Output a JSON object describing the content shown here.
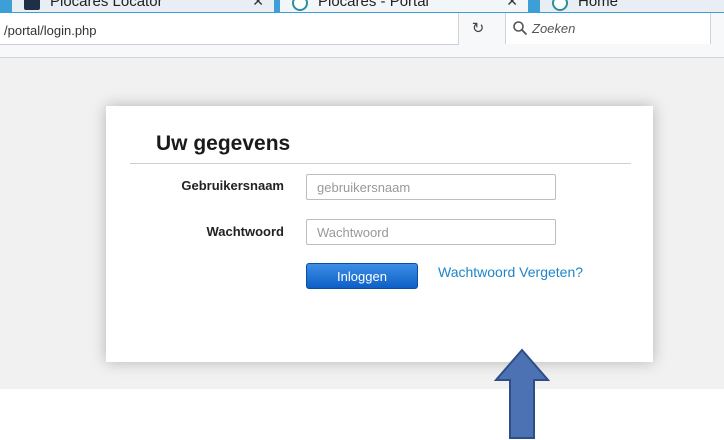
{
  "browser": {
    "tabs": [
      {
        "label": "Plocares Locator",
        "close": "✕"
      },
      {
        "label": "Plocares - Portal",
        "close": "✕"
      },
      {
        "label": "Home",
        "close": ""
      }
    ],
    "url": "/portal/login.php",
    "search_placeholder": "Zoeken",
    "reload_icon": "reload-icon",
    "search_icon": "magnifier-icon"
  },
  "login": {
    "title": "Uw gegevens",
    "username_label": "Gebruikersnaam",
    "username_placeholder": "gebruikersnaam",
    "password_label": "Wachtwoord",
    "password_placeholder": "Wachtwoord",
    "login_button": "Inloggen",
    "forgot_link": "Wachtwoord Vergeten?"
  },
  "annotation": {
    "arrow_color": "#4d72b4",
    "arrow_icon": "up-arrow-icon"
  },
  "colors": {
    "tab_bar": "#3d9fd6",
    "button": "#0d5fc6",
    "link": "#1b86c9"
  }
}
